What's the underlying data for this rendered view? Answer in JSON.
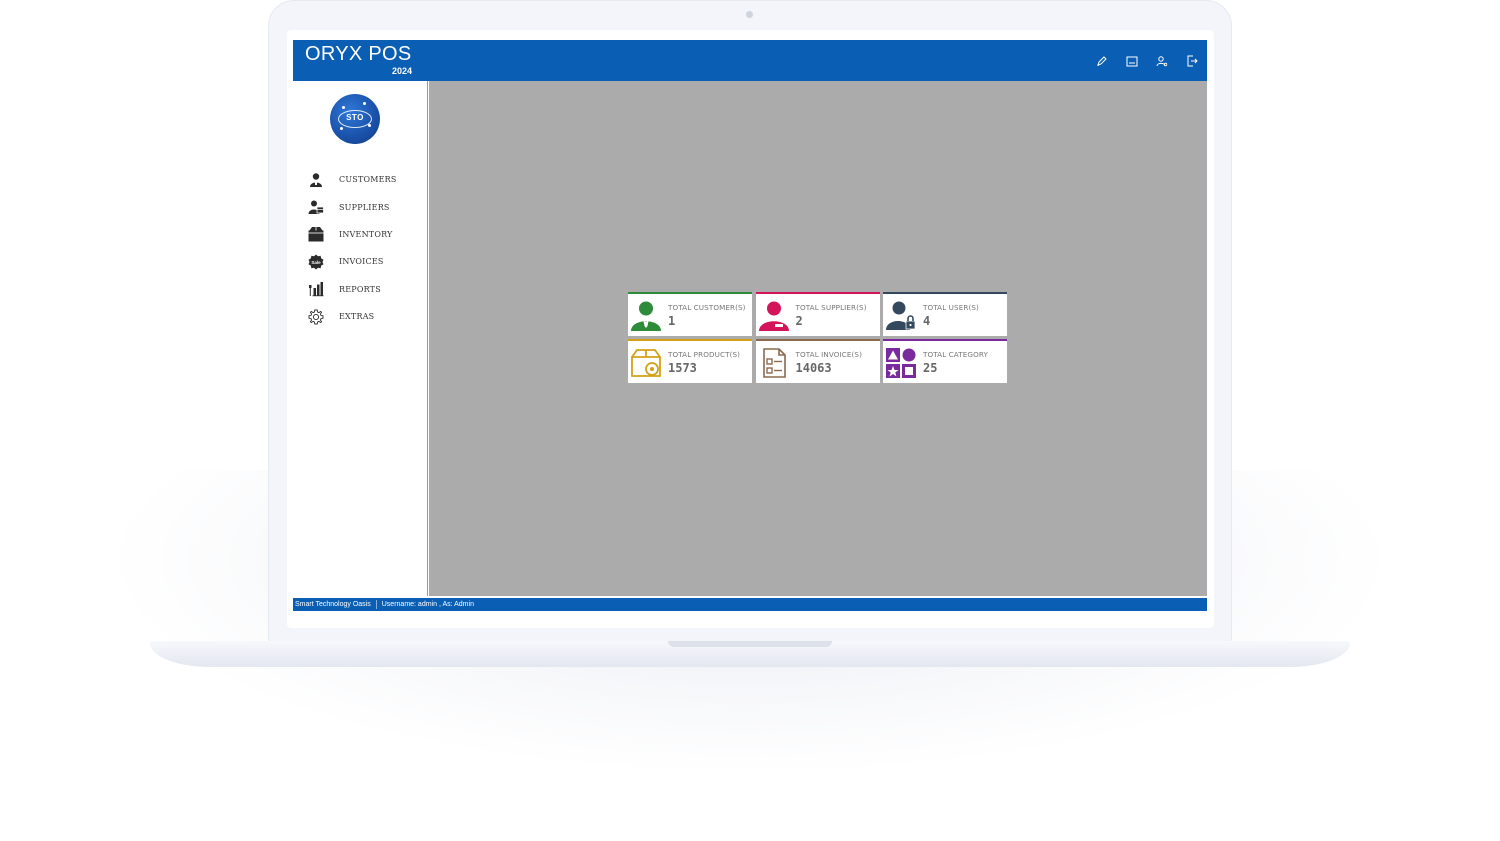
{
  "app": {
    "title": "ORYX POS",
    "year": "2024",
    "logo_text": "STO"
  },
  "topbar_icons": [
    "pen-icon",
    "keyboard-icon",
    "user-settings-icon",
    "logout-icon"
  ],
  "sidebar": {
    "items": [
      {
        "label": "CUSTOMERS",
        "icon": "customer-icon"
      },
      {
        "label": "SUPPLIERS",
        "icon": "supplier-icon"
      },
      {
        "label": "INVENTORY",
        "icon": "box-icon"
      },
      {
        "label": "INVOICES",
        "icon": "sale-badge-icon"
      },
      {
        "label": "REPORTS",
        "icon": "report-chart-icon"
      },
      {
        "label": "EXTRAS",
        "icon": "gear-icon"
      }
    ]
  },
  "dashboard": {
    "cards": [
      {
        "label": "TOTAL CUSTOMER(S)",
        "value": "1",
        "color": "#2e8b3a",
        "icon": "customer-icon"
      },
      {
        "label": "TOTAL SUPPLIER(S)",
        "value": "2",
        "color": "#d4145a",
        "icon": "supplier-icon"
      },
      {
        "label": "TOTAL USER(S)",
        "value": "4",
        "color": "#34495e",
        "icon": "user-lock-icon"
      },
      {
        "label": "TOTAL PRODUCT(S)",
        "value": "1573",
        "color": "#d4a017",
        "icon": "product-box-icon"
      },
      {
        "label": "TOTAL INVOICE(S)",
        "value": "14063",
        "color": "#8b6a4f",
        "icon": "invoice-doc-icon"
      },
      {
        "label": "TOTAL CATEGORY",
        "value": "25",
        "color": "#7b2a9e",
        "icon": "category-shapes-icon"
      }
    ]
  },
  "statusbar": {
    "company": "Smart Technology Oasis",
    "user_info": "Username: admin , As: Admin"
  },
  "colors": {
    "brand_blue": "#0a5fb4",
    "main_bg": "#ababab"
  }
}
